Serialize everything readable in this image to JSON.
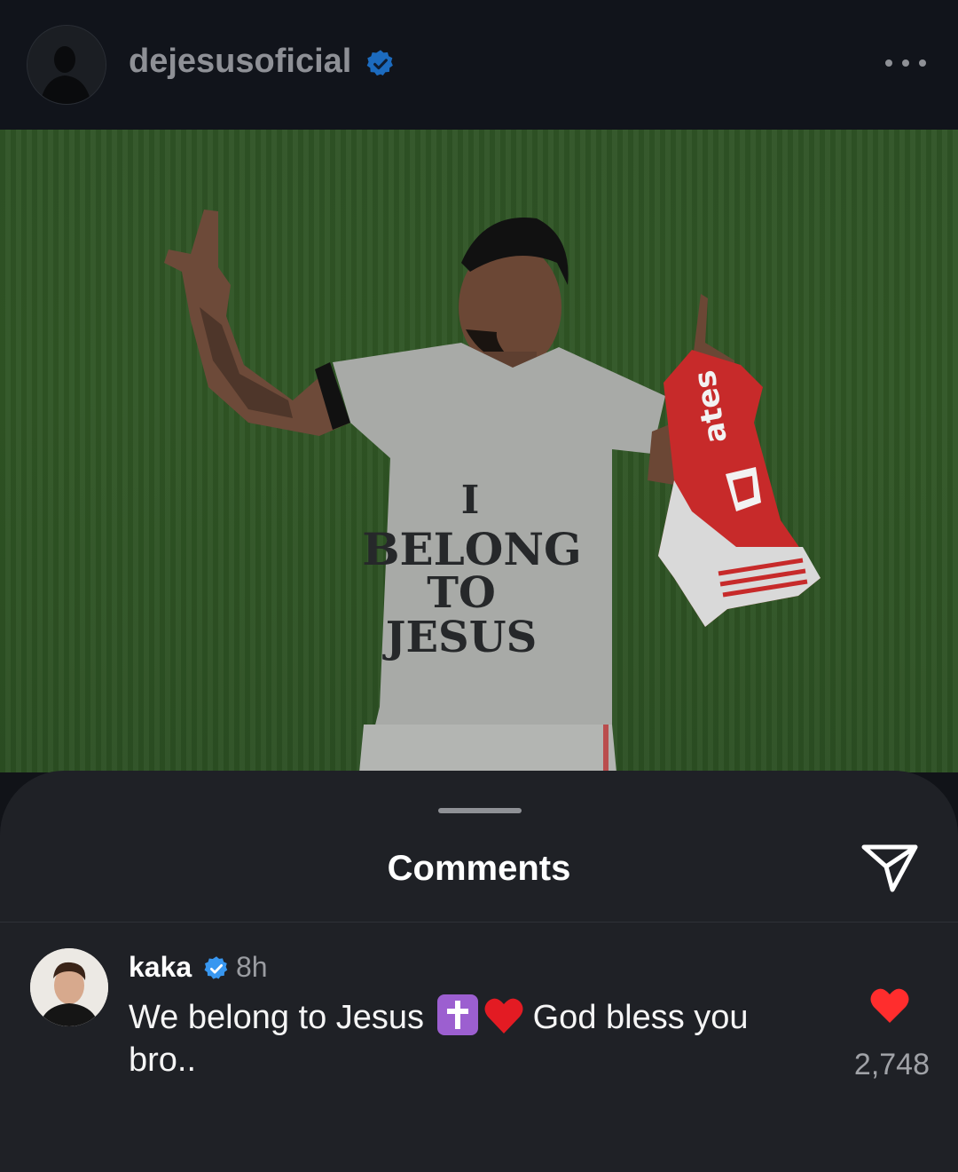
{
  "header": {
    "username": "dejesusoficial",
    "verified": true,
    "icons": {
      "avatar": "profile-avatar",
      "verified": "verified-badge-icon",
      "more": "more-options-icon"
    }
  },
  "post": {
    "shirt_text": [
      "I",
      "BELONG",
      "TO",
      "JESUS"
    ],
    "jersey_text": "ates"
  },
  "comments_sheet": {
    "title": "Comments",
    "send_icon": "send-icon",
    "comments": [
      {
        "username": "kaka",
        "verified": true,
        "time": "8h",
        "text_before": "We belong to Jesus",
        "emojis": [
          "latin-cross-emoji",
          "red-heart-emoji"
        ],
        "text_after": "God bless you bro..",
        "likes": "2,748",
        "liked": true
      }
    ]
  },
  "colors": {
    "background": "#111318",
    "sheet": "#1f2126",
    "verified": "#3897f0",
    "like": "#ff2d2d",
    "muted_text": "#8e9096"
  }
}
